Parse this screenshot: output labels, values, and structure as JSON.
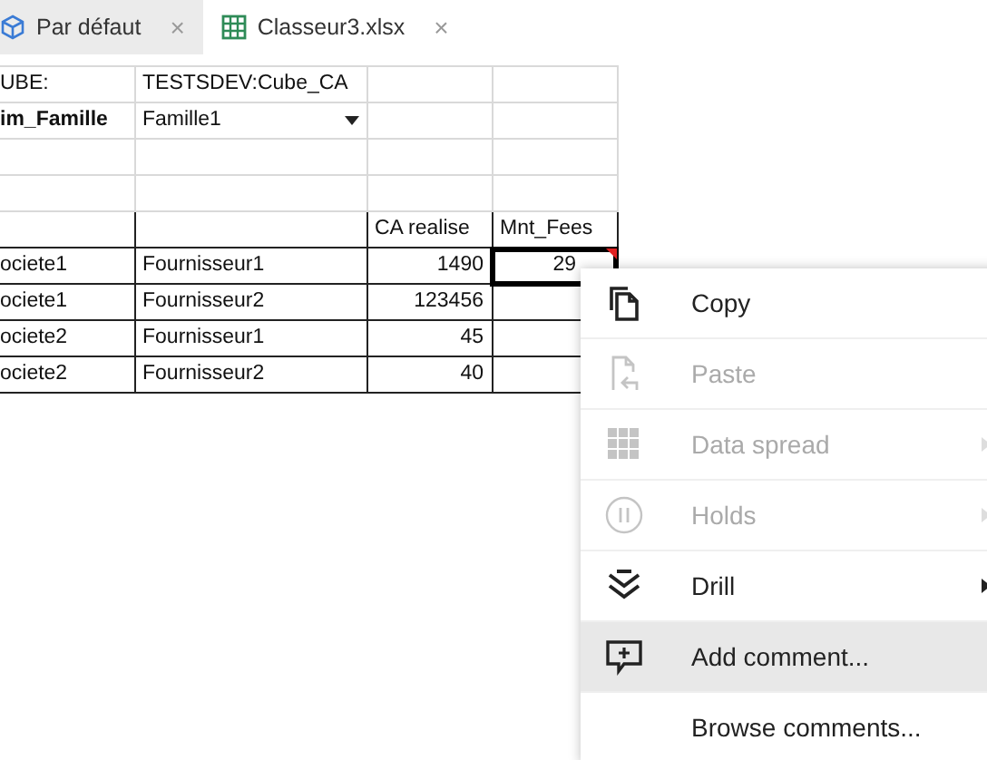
{
  "tabs": [
    {
      "label": "Par défaut",
      "kind": "cube",
      "selected": false,
      "close": "×"
    },
    {
      "label": "Classeur3.xlsx",
      "kind": "sheet",
      "selected": true,
      "close": "×"
    }
  ],
  "sheet": {
    "rows": [
      {
        "bordered": false,
        "cells": [
          {
            "text": "UBE:",
            "kind": "text",
            "selected": false
          },
          {
            "text": "TESTSDEV:Cube_CA",
            "kind": "text",
            "selected": false
          },
          {
            "kind": "empty",
            "selected": false
          },
          {
            "kind": "empty",
            "selected": false
          }
        ]
      },
      {
        "bordered": false,
        "cells": [
          {
            "text": "im_Famille",
            "kind": "text",
            "bold": true,
            "selected": false
          },
          {
            "text": "Famille1",
            "kind": "dropdown",
            "selected": false
          },
          {
            "kind": "empty",
            "selected": false
          },
          {
            "kind": "empty",
            "selected": false
          }
        ]
      },
      {
        "bordered": false,
        "cells": [
          {
            "kind": "empty",
            "selected": false
          },
          {
            "kind": "empty",
            "selected": false
          },
          {
            "kind": "empty",
            "selected": false
          },
          {
            "kind": "empty",
            "selected": false
          }
        ]
      },
      {
        "bordered": false,
        "cells": [
          {
            "kind": "empty",
            "selected": false
          },
          {
            "kind": "empty",
            "selected": false
          },
          {
            "kind": "empty",
            "selected": false
          },
          {
            "kind": "empty",
            "selected": false
          }
        ]
      },
      {
        "bordered": true,
        "cells": [
          {
            "kind": "empty",
            "selected": false
          },
          {
            "kind": "empty",
            "selected": false
          },
          {
            "text": "CA realise",
            "kind": "text",
            "selected": false
          },
          {
            "text": "Mnt_Fees",
            "kind": "text",
            "selected": false
          }
        ]
      },
      {
        "bordered": true,
        "cells": [
          {
            "text": "ociete1",
            "kind": "text",
            "selected": false
          },
          {
            "text": "Fournisseur1",
            "kind": "text",
            "selected": false
          },
          {
            "text": "1490",
            "kind": "number",
            "selected": false
          },
          {
            "text": "29",
            "kind": "number",
            "selected": true,
            "commented": true
          }
        ]
      },
      {
        "bordered": true,
        "cells": [
          {
            "text": "ociete1",
            "kind": "text",
            "selected": false
          },
          {
            "text": "Fournisseur2",
            "kind": "text",
            "selected": false
          },
          {
            "text": "123456",
            "kind": "number",
            "selected": false
          },
          {
            "kind": "empty",
            "selected": false
          }
        ]
      },
      {
        "bordered": true,
        "cells": [
          {
            "text": "ociete2",
            "kind": "text",
            "selected": false
          },
          {
            "text": "Fournisseur1",
            "kind": "text",
            "selected": false
          },
          {
            "text": "45",
            "kind": "number",
            "selected": false
          },
          {
            "kind": "empty",
            "selected": false
          }
        ]
      },
      {
        "bordered": true,
        "cells": [
          {
            "text": "ociete2",
            "kind": "text",
            "selected": false
          },
          {
            "text": "Fournisseur2",
            "kind": "text",
            "selected": false
          },
          {
            "text": "40",
            "kind": "number",
            "selected": false
          },
          {
            "kind": "empty",
            "selected": false
          }
        ]
      }
    ]
  },
  "context_menu": {
    "items": [
      {
        "label": "Copy",
        "kind": "copy",
        "disabled": false,
        "submenu": false,
        "selected": false
      },
      {
        "label": "Paste",
        "kind": "paste",
        "disabled": true,
        "submenu": false,
        "selected": false
      },
      {
        "label": "Data spread",
        "kind": "spread",
        "disabled": true,
        "submenu": true,
        "selected": false
      },
      {
        "label": "Holds",
        "kind": "hold",
        "disabled": true,
        "submenu": true,
        "selected": false
      },
      {
        "label": "Drill",
        "kind": "drill",
        "disabled": false,
        "submenu": true,
        "selected": false
      },
      {
        "label": "Add comment...",
        "kind": "comment",
        "disabled": false,
        "submenu": false,
        "selected": true
      },
      {
        "label": "Browse comments...",
        "kind": "plain",
        "disabled": false,
        "submenu": false,
        "selected": false
      }
    ]
  }
}
